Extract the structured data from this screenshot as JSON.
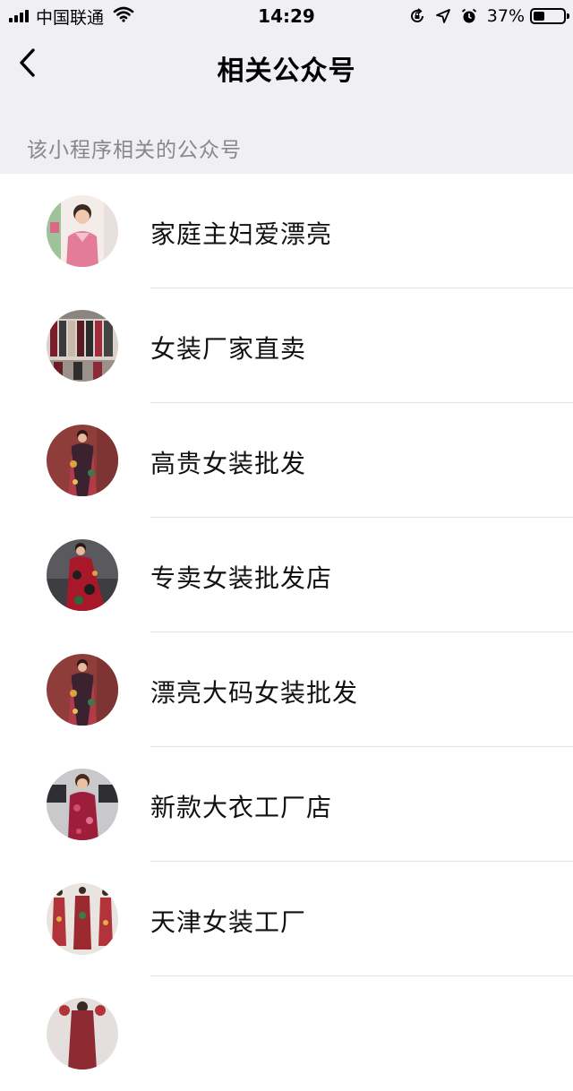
{
  "status_bar": {
    "carrier": "中国联通",
    "time": "14:29",
    "battery": "37%",
    "battery_level": 0.37,
    "icons": [
      "signal-icon",
      "wifi-icon",
      "orientation-lock-icon",
      "location-icon",
      "alarm-icon",
      "battery-icon"
    ]
  },
  "nav": {
    "back_icon": "chevron-left-icon",
    "title": "相关公众号"
  },
  "section": {
    "header": "该小程序相关的公众号"
  },
  "accounts": [
    {
      "name": "家庭主妇爱漂亮",
      "avatar": "woman-pink-top-photo"
    },
    {
      "name": "女装厂家直卖",
      "avatar": "clothing-rack-photo"
    },
    {
      "name": "高贵女装批发",
      "avatar": "floral-coat-photo"
    },
    {
      "name": "专卖女装批发店",
      "avatar": "red-dress-photo"
    },
    {
      "name": "漂亮大码女装批发",
      "avatar": "floral-coat-photo"
    },
    {
      "name": "新款大衣工厂店",
      "avatar": "woman-red-dress-photo"
    },
    {
      "name": "天津女装工厂",
      "avatar": "three-dresses-photo"
    },
    {
      "name": "",
      "avatar": "dress-photo"
    }
  ]
}
